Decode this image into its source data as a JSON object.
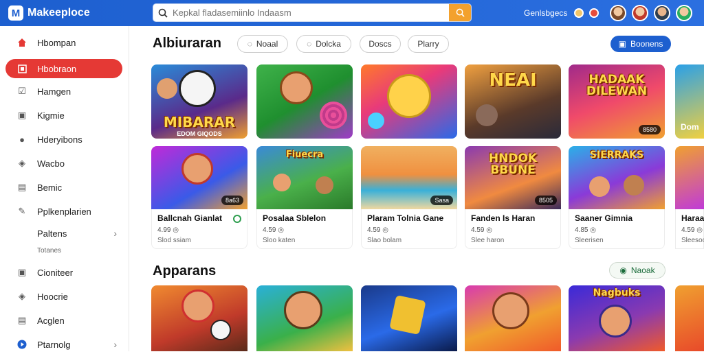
{
  "header": {
    "brand": "Makeeploce",
    "search_placeholder": "Kepkal fladasemiinlo Indaasm",
    "top_link": "Genlsbgecs"
  },
  "sidebar": {
    "items": [
      {
        "label": "Hbompan",
        "icon": "home-icon"
      },
      {
        "label": "Hbobraon",
        "icon": "grid-icon"
      },
      {
        "label": "Hamgen",
        "icon": "check-icon"
      },
      {
        "label": "Kigmie",
        "icon": "square-icon"
      },
      {
        "label": "Hderyibons",
        "icon": "user-icon"
      },
      {
        "label": "Wacbo",
        "icon": "tag-icon"
      },
      {
        "label": "Bemic",
        "icon": "list-icon"
      },
      {
        "label": "Pplkenplarien",
        "icon": "pencil-icon"
      },
      {
        "label": "Paltens",
        "icon": ""
      },
      {
        "label": "Cioniteer",
        "icon": "square-icon"
      },
      {
        "label": "Hoocrie",
        "icon": "tag-icon"
      },
      {
        "label": "Acglen",
        "icon": "list-icon"
      },
      {
        "label": "Ptarnolg",
        "icon": "play-icon"
      }
    ],
    "sub_label": "Totanes"
  },
  "section1": {
    "title": "Albiuraran",
    "chips": [
      "Noaal",
      "Dolcka",
      "Doscs",
      "Plarry"
    ],
    "browse_label": "Boonens"
  },
  "row1": [
    {
      "banner": "MIBARAR",
      "sub": "EDOM GIQODS"
    },
    {
      "banner": ""
    },
    {
      "banner": ""
    },
    {
      "banner": "NEAI"
    },
    {
      "banner": "HADAAK DILEWAN",
      "pill": "8580"
    },
    {
      "banner": "Dom"
    }
  ],
  "row2": [
    {
      "banner": "",
      "pill": "8a63",
      "title": "Ballcnah Gianlat",
      "rating": "4.99 ◎",
      "sub": "Slod ssiam"
    },
    {
      "banner": "Fiuecra",
      "title": "Posalaa Sblelon",
      "rating": "4.59 ◎",
      "sub": "Sloo katen"
    },
    {
      "banner": "",
      "pill": "Sasa",
      "title": "Plaram Tolnia Gane",
      "rating": "4.59 ◎",
      "sub": "Slao bolam"
    },
    {
      "banner": "HNDOK BBUNE",
      "pill": "8505",
      "title": "Fanden Is Haran",
      "rating": "4.59 ◎",
      "sub": "Slee haron"
    },
    {
      "banner": "SIERRAKS",
      "title": "Saaner Gimnia",
      "rating": "4.85 ◎",
      "sub": "Sleerisen"
    },
    {
      "banner": "",
      "title": "Haraa",
      "rating": "4.59 ◎",
      "sub": "Sleesoo"
    }
  ],
  "section2": {
    "title": "Apparans",
    "see_label": "Naoak"
  },
  "row3": [
    {
      "banner": ""
    },
    {
      "banner": ""
    },
    {
      "banner": ""
    },
    {
      "banner": ""
    },
    {
      "banner": "Nagbuks"
    },
    {
      "banner": ""
    }
  ],
  "colors": {
    "topbar": "#1d5fcf",
    "active": "#e53935",
    "accent": "#f3a12d",
    "button": "#1d5fcf"
  }
}
